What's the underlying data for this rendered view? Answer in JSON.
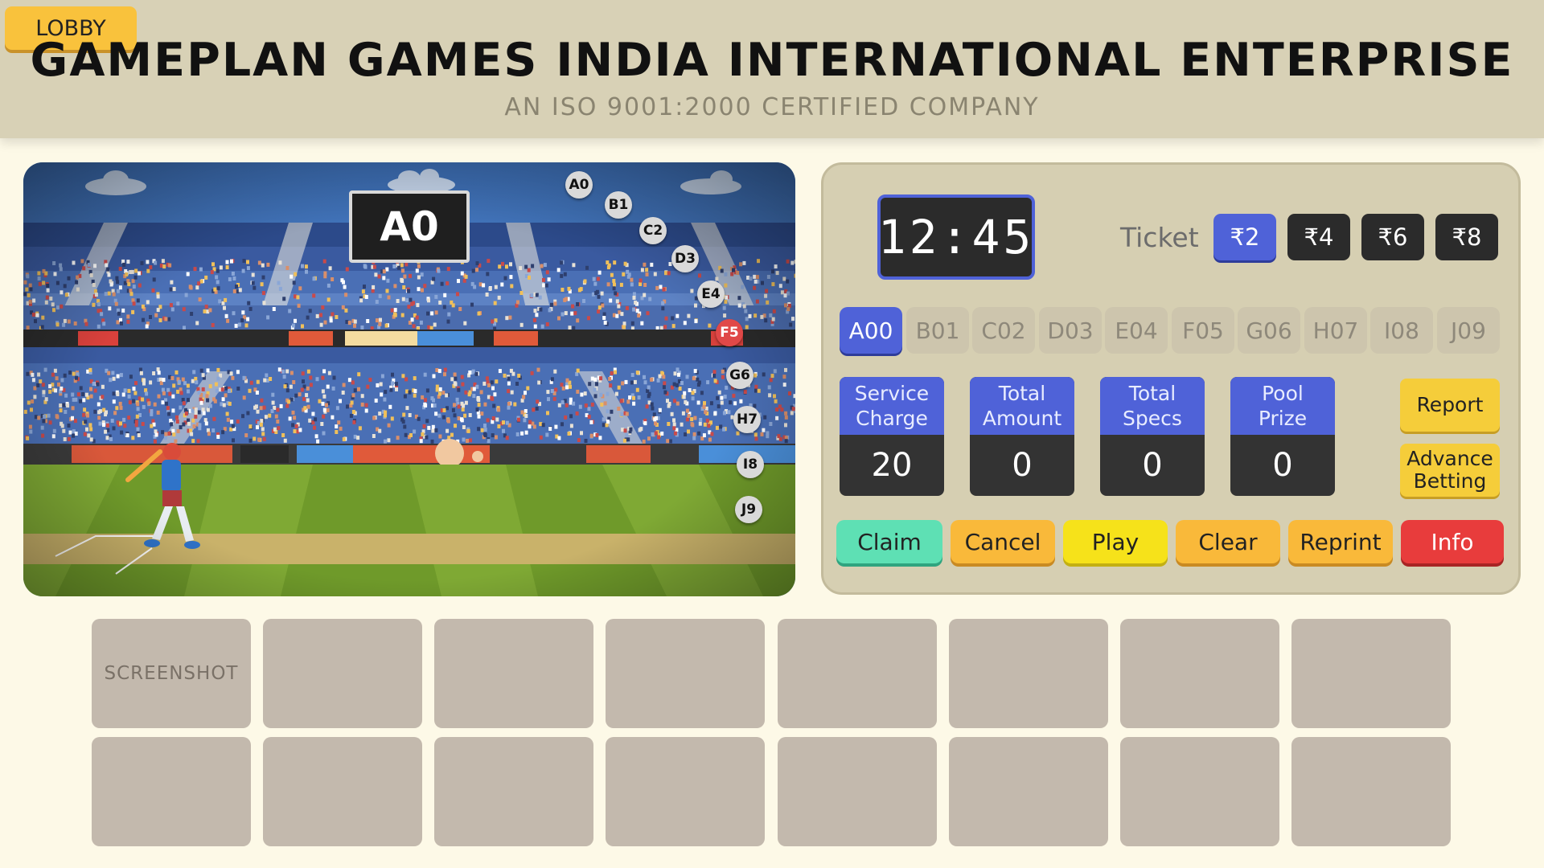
{
  "header": {
    "lobby_label": "LOBBY",
    "title": "GAMEPLAN GAMES INDIA INTERNATIONAL ENTERPRISE",
    "subtitle": "AN ISO 9001:2000 CERTIFIED COMPANY"
  },
  "scene": {
    "result": "A0",
    "sequence": [
      "A0",
      "B1",
      "C2",
      "D3",
      "E4",
      "F5",
      "G6",
      "H7",
      "I8",
      "J9"
    ],
    "highlighted": "F5"
  },
  "panel": {
    "timer": "12:45",
    "ticket_label": "Ticket",
    "ticket_options": [
      "₹2",
      "₹4",
      "₹6",
      "₹8"
    ],
    "ticket_selected": "₹2",
    "tabs": [
      "A00",
      "B01",
      "C02",
      "D03",
      "E04",
      "F05",
      "G06",
      "H07",
      "I08",
      "J09"
    ],
    "tab_selected": "A00",
    "stats": [
      {
        "label": "Service Charge",
        "value": "20"
      },
      {
        "label": "Total Amount",
        "value": "0"
      },
      {
        "label": "Total Specs",
        "value": "0"
      },
      {
        "label": "Pool Prize",
        "value": "0"
      }
    ],
    "side_buttons": {
      "report": "Report",
      "advance": "Advance Betting"
    },
    "actions": [
      {
        "label": "Claim",
        "color": "#5ee0b4"
      },
      {
        "label": "Cancel",
        "color": "#f9b93a"
      },
      {
        "label": "Play",
        "color": "#f6e21a"
      },
      {
        "label": "Clear",
        "color": "#f9b93a"
      },
      {
        "label": "Reprint",
        "color": "#f9b93a"
      },
      {
        "label": "Info",
        "color": "#e83c3c"
      }
    ]
  },
  "history": {
    "slots": [
      "SCREENSHOT",
      "",
      "",
      "",
      "",
      "",
      "",
      "",
      "",
      "",
      "",
      "",
      "",
      "",
      "",
      ""
    ]
  },
  "colors": {
    "accent": "#4f62d8",
    "header_bg": "#d8d1b6",
    "page_bg": "#fdf9e7"
  }
}
